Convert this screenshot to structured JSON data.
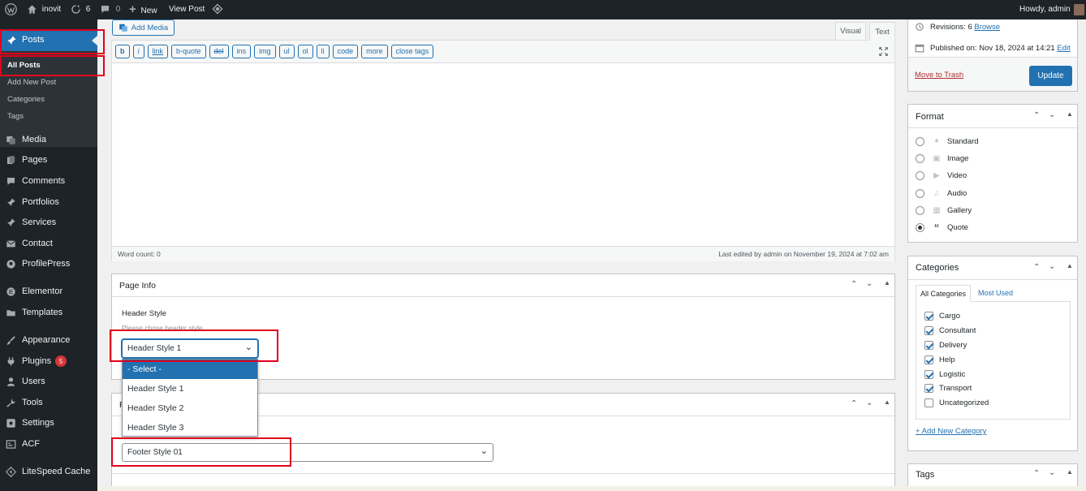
{
  "adminbar": {
    "site_name": "inovit",
    "updates_count": "6",
    "comments_count": "0",
    "new_label": "New",
    "view_post_label": "View Post",
    "howdy": "Howdy, admin"
  },
  "sidebar": {
    "posts_label": "Posts",
    "sub_items": [
      "All Posts",
      "Add New Post",
      "Categories",
      "Tags"
    ],
    "items": [
      {
        "label": "Media",
        "icon": "media-icon"
      },
      {
        "label": "Pages",
        "icon": "pages-icon"
      },
      {
        "label": "Comments",
        "icon": "comments-icon"
      },
      {
        "label": "Portfolios",
        "icon": "pin-icon"
      },
      {
        "label": "Services",
        "icon": "pin-icon"
      },
      {
        "label": "Contact",
        "icon": "mail-icon"
      },
      {
        "label": "ProfilePress",
        "icon": "profilepress-icon"
      },
      {
        "label": "Elementor",
        "icon": "elementor-icon"
      },
      {
        "label": "Templates",
        "icon": "folder-icon"
      },
      {
        "label": "Appearance",
        "icon": "brush-icon"
      },
      {
        "label": "Plugins",
        "icon": "plugin-icon",
        "badge": "5"
      },
      {
        "label": "Users",
        "icon": "user-icon"
      },
      {
        "label": "Tools",
        "icon": "wrench-icon"
      },
      {
        "label": "Settings",
        "icon": "settings-icon"
      },
      {
        "label": "ACF",
        "icon": "acf-icon"
      },
      {
        "label": "LiteSpeed Cache",
        "icon": "litespeed-icon"
      }
    ]
  },
  "editor": {
    "add_media": "Add Media",
    "tab_visual": "Visual",
    "tab_text": "Text",
    "quicktags": [
      "b",
      "i",
      "link",
      "b-quote",
      "del",
      "ins",
      "img",
      "ul",
      "ol",
      "li",
      "code",
      "more",
      "close tags"
    ],
    "word_count": "Word count: 0",
    "last_edited": "Last edited by admin on November 19, 2024 at 7:02 am"
  },
  "page_info": {
    "title": "Page Info",
    "header_style_label": "Header Style",
    "header_style_desc": "Please chose header style",
    "header_style_value": "Header Style 1",
    "dropdown_options": [
      "- Select -",
      "Header Style 1",
      "Header Style 2",
      "Header Style 3"
    ],
    "second_panel_title": "F",
    "footer_style_value": "Footer Style 01"
  },
  "publish": {
    "revisions_label": "Revisions: 6",
    "browse": "Browse",
    "published_label": "Published on: Nov 18, 2024 at 14:21",
    "edit": "Edit",
    "move_to_trash": "Move to Trash",
    "update": "Update"
  },
  "format": {
    "title": "Format",
    "options": [
      {
        "label": "Standard",
        "icon": "pin-icon",
        "selected": false
      },
      {
        "label": "Image",
        "icon": "image-icon",
        "selected": false
      },
      {
        "label": "Video",
        "icon": "video-icon",
        "selected": false
      },
      {
        "label": "Audio",
        "icon": "audio-icon",
        "selected": false
      },
      {
        "label": "Gallery",
        "icon": "gallery-icon",
        "selected": false
      },
      {
        "label": "Quote",
        "icon": "quote-icon",
        "selected": true
      }
    ]
  },
  "categories": {
    "title": "Categories",
    "tab_all": "All Categories",
    "tab_most_used": "Most Used",
    "items": [
      {
        "label": "Cargo",
        "checked": true
      },
      {
        "label": "Consultant",
        "checked": true
      },
      {
        "label": "Delivery",
        "checked": true
      },
      {
        "label": "Help",
        "checked": true
      },
      {
        "label": "Logistic",
        "checked": true
      },
      {
        "label": "Transport",
        "checked": true
      },
      {
        "label": "Uncategorized",
        "checked": false
      }
    ],
    "add_new": "+ Add New Category"
  },
  "tags": {
    "title": "Tags"
  },
  "colors": {
    "accent": "#2271b1",
    "adminbar": "#1d2327",
    "highlight": "#e0001b"
  }
}
